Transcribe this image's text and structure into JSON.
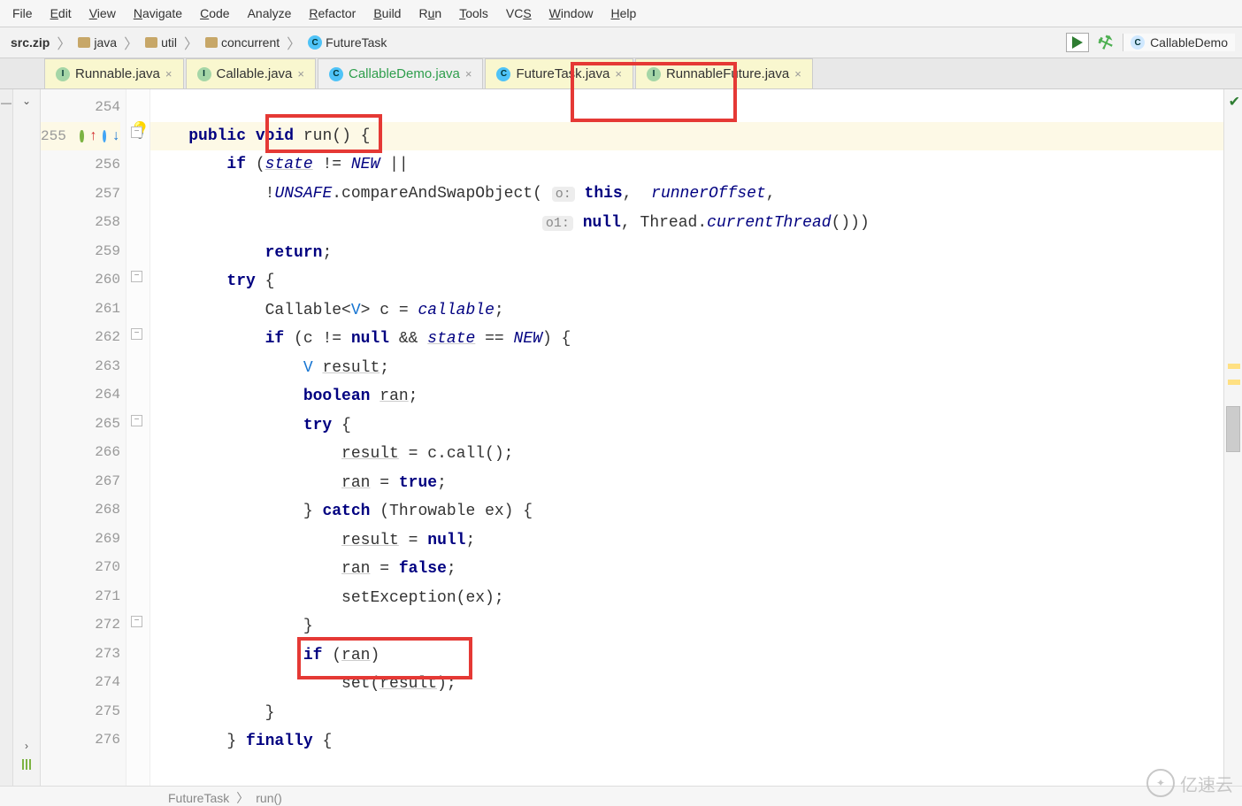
{
  "menu": [
    "File",
    "Edit",
    "View",
    "Navigate",
    "Code",
    "Analyze",
    "Refactor",
    "Build",
    "Run",
    "Tools",
    "VCS",
    "Window",
    "Help"
  ],
  "breadcrumbs": [
    {
      "label": "src.zip",
      "type": "zip"
    },
    {
      "label": "java",
      "type": "folder"
    },
    {
      "label": "util",
      "type": "folder"
    },
    {
      "label": "concurrent",
      "type": "folder"
    },
    {
      "label": "FutureTask",
      "type": "class-c"
    }
  ],
  "right_file": "CallableDemo",
  "tabs": [
    {
      "label": "Runnable.java",
      "icon": "i",
      "style": "yellow",
      "active": false
    },
    {
      "label": "Callable.java",
      "icon": "i",
      "style": "yellow",
      "active": false
    },
    {
      "label": "CallableDemo.java",
      "icon": "c",
      "style": "green",
      "active": false
    },
    {
      "label": "FutureTask.java",
      "icon": "c",
      "style": "yellow",
      "active": true
    },
    {
      "label": "RunnableFuture.java",
      "icon": "i",
      "style": "yellow",
      "active": false
    }
  ],
  "line_start": 254,
  "line_end": 276,
  "code_lines": [
    "",
    "    public void run() {",
    "        if (state != NEW ||",
    "            !UNSAFE.compareAndSwapObject( o: this,  runnerOffset,",
    "                                         o1: null, Thread.currentThread()))",
    "            return;",
    "        try {",
    "            Callable<V> c = callable;",
    "            if (c != null && state == NEW) {",
    "                V result;",
    "                boolean ran;",
    "                try {",
    "                    result = c.call();",
    "                    ran = true;",
    "                } catch (Throwable ex) {",
    "                    result = null;",
    "                    ran = false;",
    "                    setException(ex);",
    "                }",
    "                if (ran)",
    "                    set(result);",
    "            }",
    "        } finally {",
    ""
  ],
  "status_breadcrumb": [
    "FutureTask",
    "run()"
  ],
  "watermark": "亿速云"
}
